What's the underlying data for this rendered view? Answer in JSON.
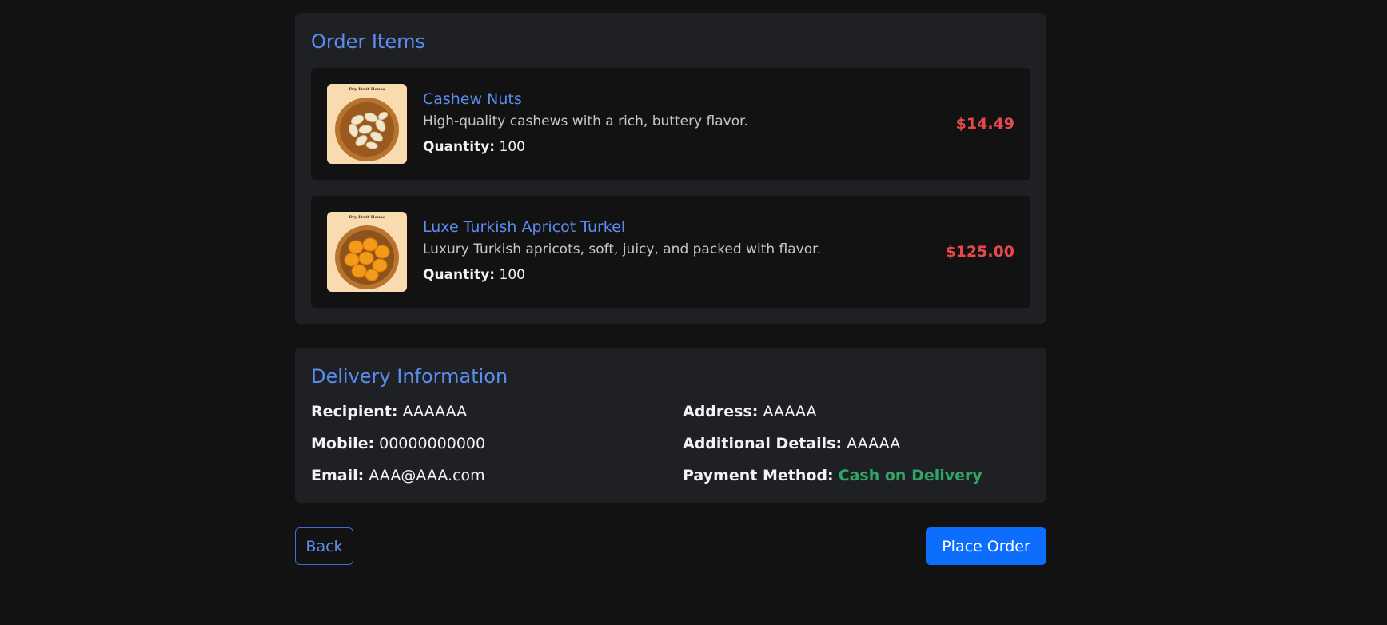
{
  "order_items": {
    "title": "Order Items",
    "items": [
      {
        "name": "Cashew Nuts",
        "description": "High-quality cashews with a rich, buttery flavor.",
        "quantity_label": "Quantity:",
        "quantity": "100",
        "price": "$14.49",
        "image_brand": "Dry Fruit House",
        "image_icon": "cashew-bowl-image"
      },
      {
        "name": "Luxe Turkish Apricot Turkel",
        "description": "Luxury Turkish apricots, soft, juicy, and packed with flavor.",
        "quantity_label": "Quantity:",
        "quantity": "100",
        "price": "$125.00",
        "image_brand": "Dry Fruit House",
        "image_icon": "apricot-bowl-image"
      }
    ]
  },
  "delivery": {
    "title": "Delivery Information",
    "recipient_label": "Recipient:",
    "recipient": "AAAAAA",
    "address_label": "Address:",
    "address": "AAAAA",
    "mobile_label": "Mobile:",
    "mobile": "00000000000",
    "additional_label": "Additional Details:",
    "additional": "AAAAA",
    "email_label": "Email:",
    "email": "AAA@AAA.com",
    "payment_label": "Payment Method:",
    "payment": "Cash on Delivery"
  },
  "actions": {
    "back_label": "Back",
    "place_order_label": "Place Order"
  },
  "colors": {
    "accent": "#5b8def",
    "price": "#e5484d",
    "payment": "#2fa665",
    "primary_button": "#0d6efd"
  }
}
